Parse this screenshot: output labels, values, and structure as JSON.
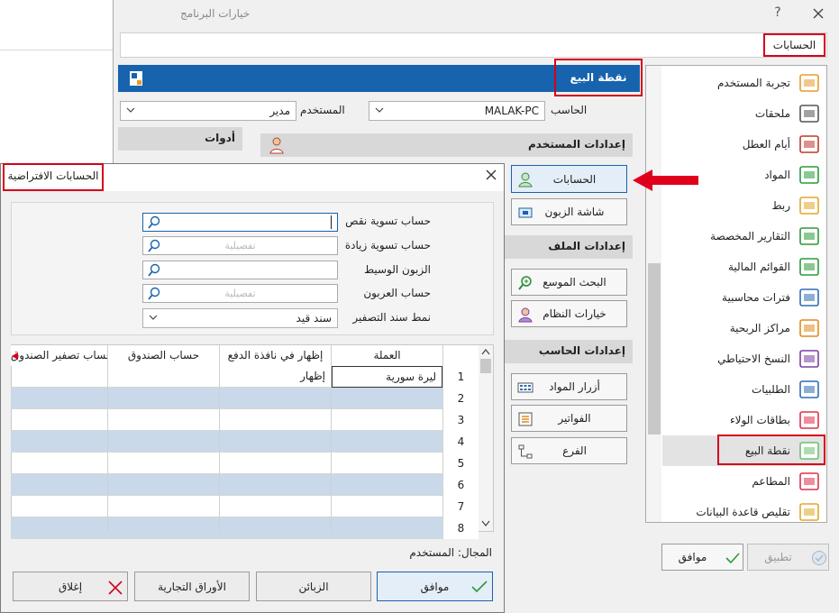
{
  "main_window": {
    "title": "خيارات البرنامج",
    "help": "?",
    "search_value": "الحسابات"
  },
  "categories": [
    {
      "label": "تجربة المستخدم",
      "icon": "user-experience-icon"
    },
    {
      "label": "ملحقات",
      "icon": "barcode-icon"
    },
    {
      "label": "أيام العطل",
      "icon": "calendar-icon"
    },
    {
      "label": "المواد",
      "icon": "materials-chart-icon"
    },
    {
      "label": "ربط",
      "icon": "coins-link-icon"
    },
    {
      "label": "التقارير المخصصة",
      "icon": "report-gear-icon"
    },
    {
      "label": "القوائم المالية",
      "icon": "dollar-cycle-icon"
    },
    {
      "label": "فترات محاسبية",
      "icon": "calendar-arrows-icon"
    },
    {
      "label": "مراكز الربحية",
      "icon": "profit-house-icon"
    },
    {
      "label": "النسخ الاحتياطي",
      "icon": "backup-disk-icon"
    },
    {
      "label": "الطلبيات",
      "icon": "truck-icon"
    },
    {
      "label": "بطاقات الولاء",
      "icon": "heart-icon"
    },
    {
      "label": "نقطة البيع",
      "icon": "shopping-bag-icon",
      "selected": true
    },
    {
      "label": "المطاعم",
      "icon": "restaurant-icon"
    },
    {
      "label": "تقليص قاعدة البيانات",
      "icon": "database-shrink-icon"
    }
  ],
  "pos": {
    "header_title": "نقطة البيع",
    "computer_label": "الحاسب",
    "computer_value": "MALAK-PC",
    "user_label": "المستخدم",
    "user_value": "مدير",
    "tools_label": "أدوات",
    "groups": {
      "user_settings": "إعدادات المستخدم",
      "file_settings": "إعدادات الملف",
      "computer_settings": "إعدادات الحاسب"
    },
    "buttons": {
      "accounts": "الحسابات",
      "customer_screen": "شاشة الزبون",
      "extended_search": "البحث الموسع",
      "system_options": "خيارات النظام",
      "material_buttons": "أزرار المواد",
      "invoices": "الفواتير",
      "branch": "الفرع"
    },
    "footer": {
      "ok": "موافق",
      "apply": "تطبيق"
    }
  },
  "dialog": {
    "title": "الحسابات الافتراضية",
    "fields": [
      {
        "label": "حساب تسوية نقص",
        "value": "",
        "placeholder": ""
      },
      {
        "label": "حساب تسوية زيادة",
        "value": "",
        "placeholder": "تفصيلية"
      },
      {
        "label": "الزبون الوسيط",
        "value": "",
        "placeholder": ""
      },
      {
        "label": "حساب العربون",
        "value": "",
        "placeholder": "تفصيلية"
      }
    ],
    "zeroing_label": "نمط سند التصفير",
    "zeroing_value": "سند قيد",
    "grid": {
      "columns": [
        "العملة",
        "إظهار في نافذة الدفع",
        "حساب الصندوق",
        "حساب تصفير الصندوق"
      ],
      "rows": [
        {
          "n": "1",
          "currency": "ليرة سورية",
          "show": "إظهار"
        },
        {
          "n": "2",
          "currency": "",
          "show": ""
        },
        {
          "n": "3",
          "currency": "",
          "show": ""
        },
        {
          "n": "4",
          "currency": "",
          "show": ""
        },
        {
          "n": "5",
          "currency": "",
          "show": ""
        },
        {
          "n": "6",
          "currency": "",
          "show": ""
        },
        {
          "n": "7",
          "currency": "",
          "show": ""
        },
        {
          "n": "8",
          "currency": "",
          "show": ""
        }
      ]
    },
    "scope": "المجال: المستخدم",
    "buttons": {
      "ok": "موافق",
      "customers": "الزبائن",
      "commercial_papers": "الأوراق التجارية",
      "close": "إغلاق"
    }
  },
  "colors": {
    "accent": "#1763ad",
    "highlight": "#d4001c",
    "row_alt": "#c9d9ea"
  }
}
